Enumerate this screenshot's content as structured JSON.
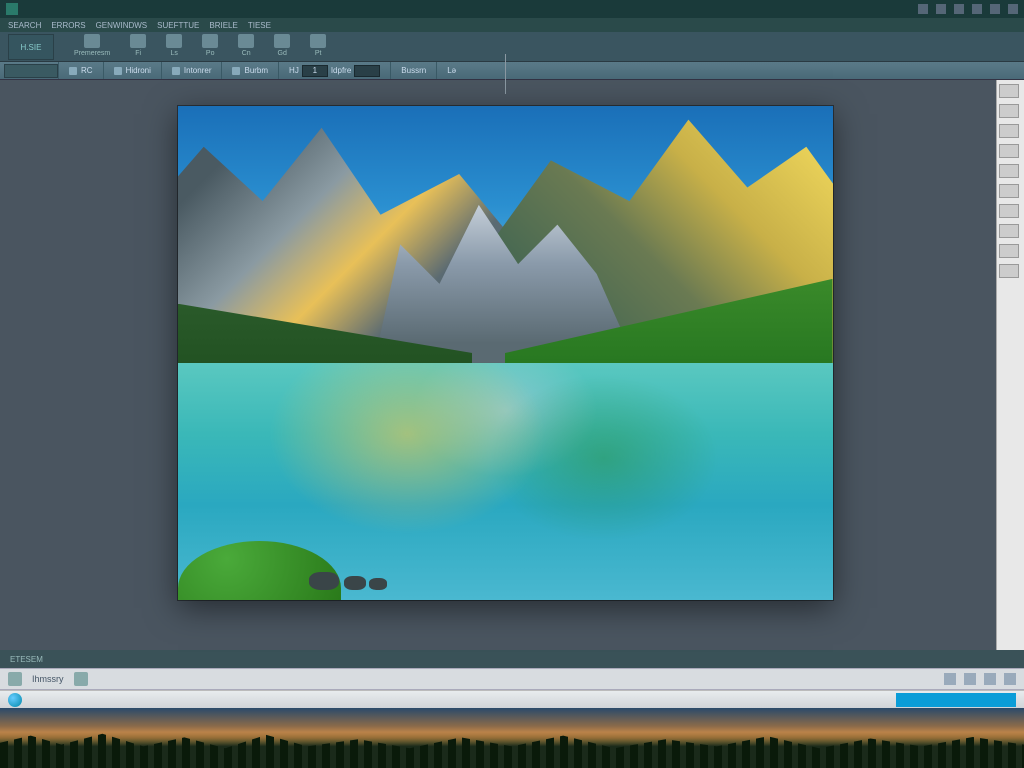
{
  "titlebar": {
    "icon": "app-icon"
  },
  "menubar": {
    "items": [
      "SEARCH",
      "ERRORS",
      "GENWINDWS",
      "SUEFTTUE",
      "BRIELE",
      "TIESE"
    ]
  },
  "ribbon": {
    "left_label": "H.SIE",
    "buttons": [
      {
        "label": "Premeresm"
      },
      {
        "label": "Fi"
      },
      {
        "label": "Ls"
      },
      {
        "label": "Po"
      },
      {
        "label": "Cn"
      },
      {
        "label": "Gd"
      },
      {
        "label": "Pt"
      }
    ]
  },
  "subribbon": {
    "left_tab": " ",
    "items": [
      {
        "label": "RC"
      },
      {
        "label": "Hidroni"
      },
      {
        "label": "Intonrer"
      },
      {
        "label": "Burbm"
      }
    ],
    "field1": {
      "label": "HJ",
      "value": "1"
    },
    "field2": {
      "label": "Idpfre",
      "value": ""
    },
    "item_last": {
      "label": "Bussrn"
    },
    "tail": {
      "label": "Lə"
    }
  },
  "status1": {
    "label": "ETESEM"
  },
  "status2": {
    "label": "Ihmssry"
  }
}
